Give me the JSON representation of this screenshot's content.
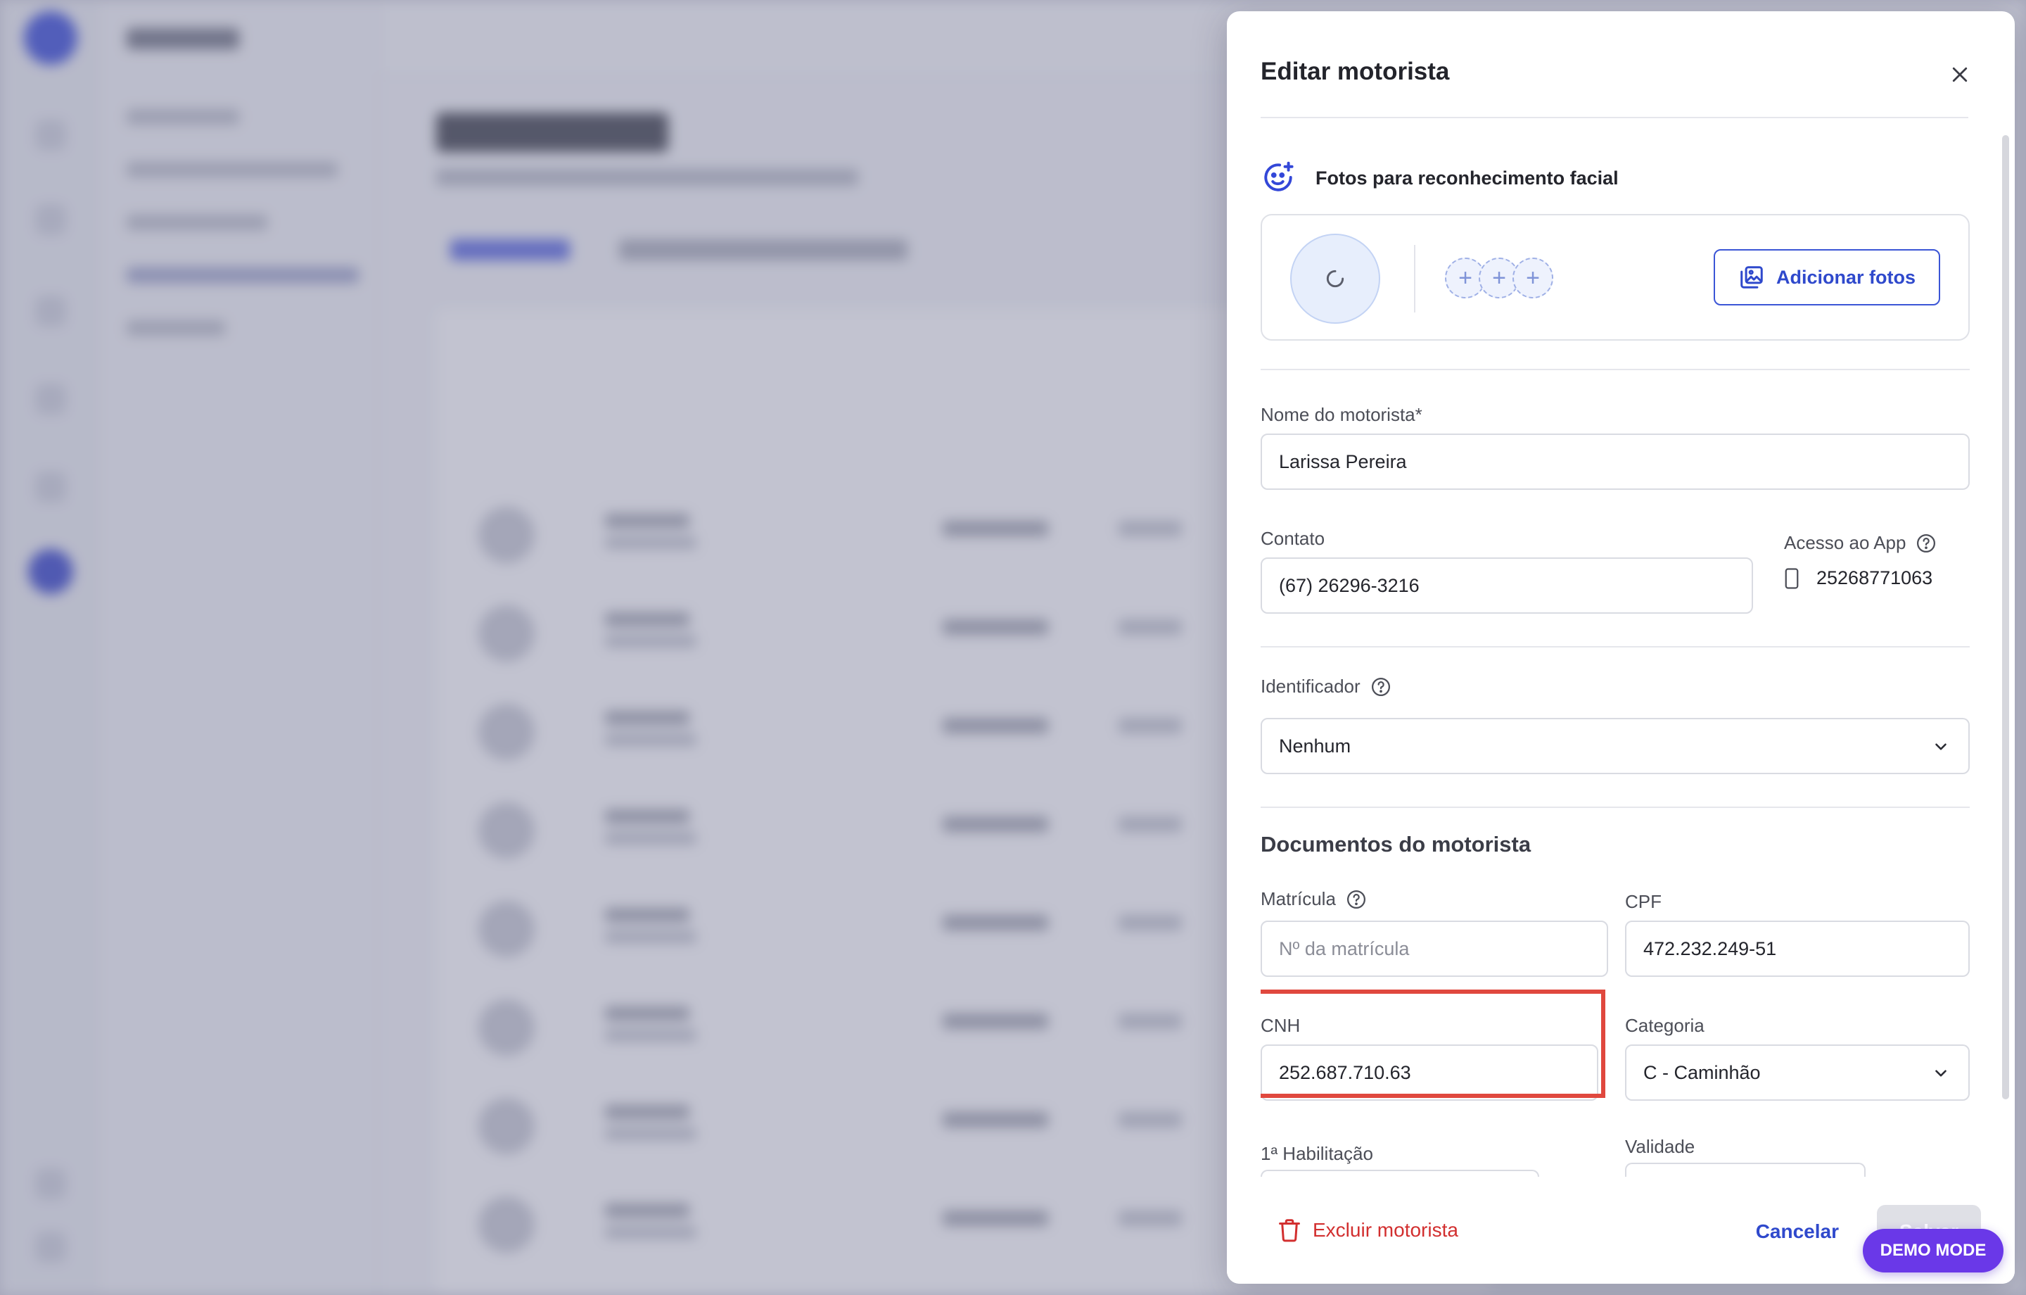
{
  "modal": {
    "title": "Editar motorista",
    "facial_section": {
      "label": "Fotos para reconhecimento facial",
      "add_button": "Adicionar fotos"
    },
    "fields": {
      "name_label": "Nome do motorista*",
      "name_value": "Larissa Pereira",
      "contact_label": "Contato",
      "contact_value": "(67) 26296-3216",
      "app_access_label": "Acesso ao App",
      "app_access_value": "25268771063",
      "identifier_label": "Identificador",
      "identifier_value": "Nenhum"
    },
    "documents": {
      "title": "Documentos do motorista",
      "registration_label": "Matrícula",
      "registration_placeholder": "Nº da matrícula",
      "cpf_label": "CPF",
      "cpf_value": "472.232.249-51",
      "cnh_label": "CNH",
      "cnh_value": "252.687.710.63",
      "category_label": "Categoria",
      "category_value": "C - Caminhão",
      "first_license_label": "1ª Habilitação",
      "validity_label": "Validade"
    },
    "footer": {
      "delete_label": "Excluir motorista",
      "cancel_label": "Cancelar",
      "save_label": "Salvar"
    }
  },
  "badge": {
    "label": "DEMO MODE"
  },
  "colors": {
    "accent": "#2f49cc",
    "danger": "#d22f2f",
    "highlight": "#e0483e",
    "badge": "#6a38e8"
  }
}
